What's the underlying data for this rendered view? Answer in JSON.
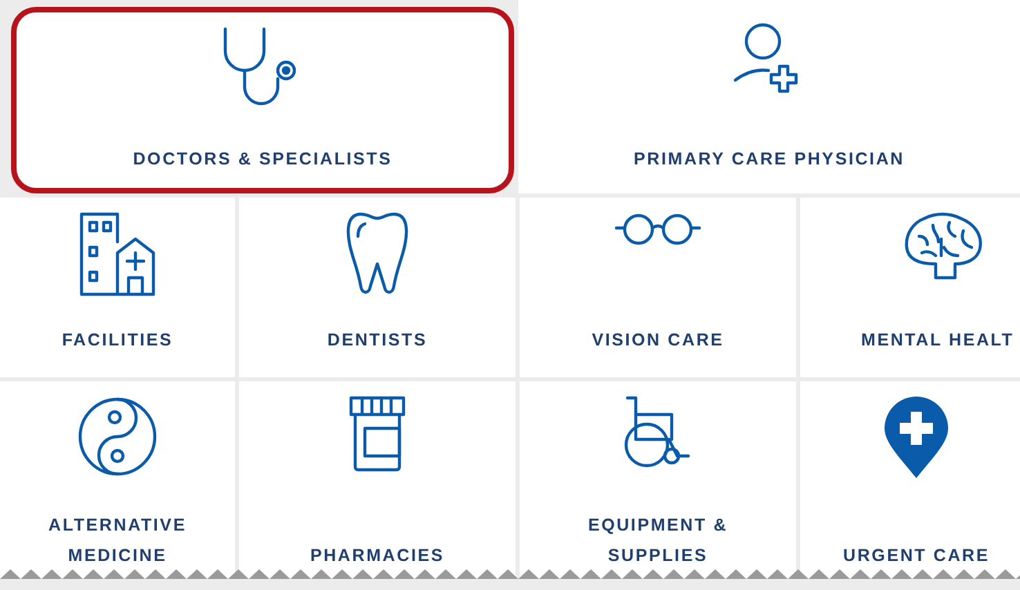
{
  "featured": [
    {
      "label": "DOCTORS & SPECIALISTS",
      "selected": true
    },
    {
      "label": "PRIMARY CARE PHYSICIAN",
      "selected": false
    }
  ],
  "categories": [
    {
      "label": "FACILITIES",
      "selected": false
    },
    {
      "label": "DENTISTS",
      "selected": false
    },
    {
      "label": "VISION CARE",
      "selected": false
    },
    {
      "label": "MENTAL HEALT",
      "selected": false
    },
    {
      "label": "ALTERNATIVE MEDICINE",
      "selected": false
    },
    {
      "label": "PHARMACIES",
      "selected": false
    },
    {
      "label": "EQUIPMENT & SUPPLIES",
      "selected": false
    },
    {
      "label": "URGENT CARE",
      "selected": false
    }
  ]
}
